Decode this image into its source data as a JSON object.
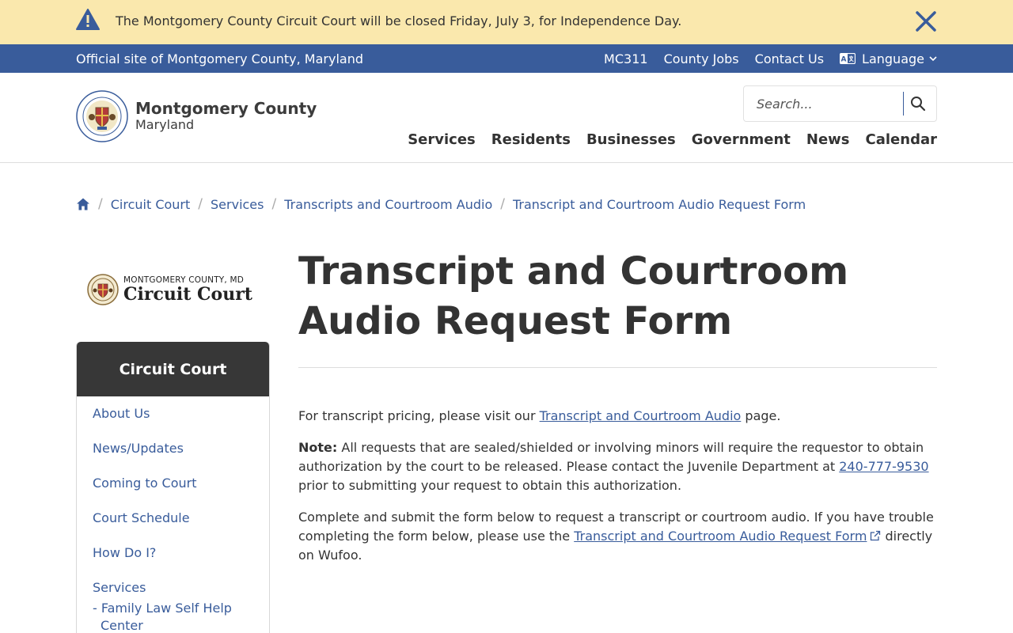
{
  "alert": {
    "message": "The Montgomery County Circuit Court will be closed Friday, July 3, for Independence Day.",
    "icon": "warning-icon",
    "close_icon": "close-icon"
  },
  "utility": {
    "official_site": "Official site of Montgomery County, Maryland",
    "links": [
      "MC311",
      "County Jobs",
      "Contact Us"
    ],
    "language_label": "Language"
  },
  "header": {
    "logo_name": "Montgomery County",
    "logo_state": "Maryland",
    "search_placeholder": "Search...",
    "nav": [
      "Services",
      "Residents",
      "Businesses",
      "Government",
      "News",
      "Calendar"
    ]
  },
  "breadcrumb": [
    "Circuit Court",
    "Services",
    "Transcripts and Courtroom Audio",
    "Transcript and Courtroom Audio Request Form"
  ],
  "sidebar": {
    "logo_small": "MONTGOMERY COUNTY, MD",
    "logo_big": "Circuit Court",
    "heading": "Circuit Court",
    "items": [
      "About Us",
      "News/Updates",
      "Coming to Court",
      "Court Schedule",
      "How Do I?",
      "Services"
    ],
    "sub_item": "- Family Law Self Help Center"
  },
  "main": {
    "title": "Transcript and Courtroom Audio Request Form",
    "p1_before": "For transcript pricing, please visit our ",
    "p1_link": "Transcript and Courtroom Audio",
    "p1_after": " page.",
    "note_label": "Note:",
    "note_before": " All requests that are sealed/shielded or involving minors will require the requestor to obtain authorization by the court to be released. Please contact the Juvenile Department at ",
    "note_phone": "240-777-9530",
    "note_after": " prior to submitting your request to obtain this authorization.",
    "p3_before": "Complete and submit the form below to request a transcript or courtroom audio. If you have trouble completing the form below, please use the ",
    "p3_link": "Transcript and Courtroom Audio Request Form",
    "p3_after": " directly on Wufoo."
  },
  "colors": {
    "alert_bg": "#fae8ad",
    "brand_blue": "#395c9b",
    "sidebar_head": "#373737"
  }
}
